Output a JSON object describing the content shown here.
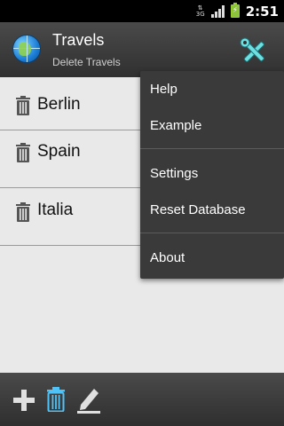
{
  "status_bar": {
    "network": "3G",
    "time": "2:51"
  },
  "action_bar": {
    "title": "Travels",
    "subtitle": "Delete Travels"
  },
  "list": {
    "items": [
      {
        "label": "Berlin"
      },
      {
        "label": "Spain"
      },
      {
        "label": "Italia"
      }
    ]
  },
  "menu": {
    "items": [
      "Help",
      "Example",
      "Settings",
      "Reset Database",
      "About"
    ]
  },
  "bottom_bar": {
    "icons": [
      "add-icon",
      "trash-icon",
      "edit-icon"
    ]
  },
  "colors": {
    "accent_blue": "#4fc3f7",
    "battery_green": "#8cc43c",
    "tools_icon": "#6fe0e0"
  }
}
